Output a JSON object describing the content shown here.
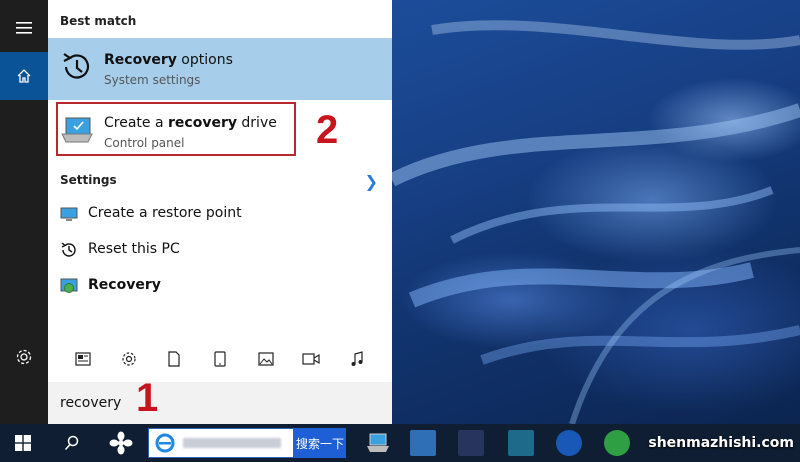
{
  "search_panel": {
    "best_match_heading": "Best match",
    "best_match": {
      "title_bold": "Recovery",
      "title_rest": " options",
      "subtitle": "System settings"
    },
    "second_result": {
      "title_prefix": "Create a ",
      "title_bold": "recovery",
      "title_suffix": " drive",
      "subtitle": "Control panel"
    },
    "settings_heading": "Settings",
    "settings_items": [
      {
        "label": "Create a restore point",
        "icon": "monitor-icon"
      },
      {
        "label": "Reset this PC",
        "icon": "history-icon"
      },
      {
        "label": "Recovery",
        "icon": "recovery-icon"
      }
    ],
    "filter_icons": [
      "news-icon",
      "gear-icon",
      "document-icon",
      "tablet-icon",
      "image-icon",
      "video-icon",
      "music-icon"
    ],
    "search_query": "recovery"
  },
  "annotations": {
    "step1": "1",
    "step2": "2"
  },
  "taskbar": {
    "search_button_label": "搜索一下",
    "watermark": "shenmazhishi.com"
  },
  "colors": {
    "highlight": "#a6cdea",
    "accent_blue": "#0a5396",
    "annotation_red": "#c8141c"
  }
}
